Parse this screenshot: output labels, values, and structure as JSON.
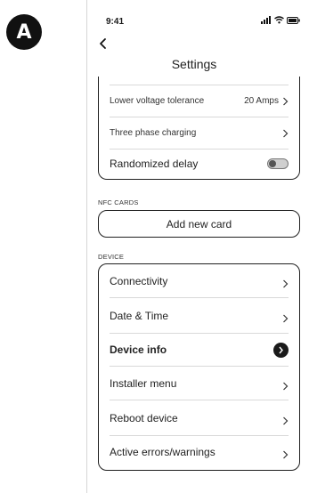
{
  "badge": "A",
  "status_bar": {
    "time": "9:41"
  },
  "header": {
    "title": "Settings"
  },
  "top_group": {
    "rows": [
      {
        "label": "Lower voltage tolerance",
        "value": "20 Amps"
      },
      {
        "label": "Three phase charging",
        "value": ""
      },
      {
        "label": "Randomized delay",
        "toggle": false
      }
    ]
  },
  "nfc": {
    "section_label": "NFC CARDS",
    "add_button": "Add new card"
  },
  "device": {
    "section_label": "DEVICE",
    "rows": [
      {
        "label": "Connectivity"
      },
      {
        "label": "Date & Time"
      },
      {
        "label": "Device info",
        "selected": true
      },
      {
        "label": "Installer menu"
      },
      {
        "label": "Reboot device"
      },
      {
        "label": "Active errors/warnings"
      }
    ]
  },
  "colors": {
    "border": "#1f1f1f",
    "divider": "#d9d9d9",
    "accent": "#1a1a1a"
  }
}
